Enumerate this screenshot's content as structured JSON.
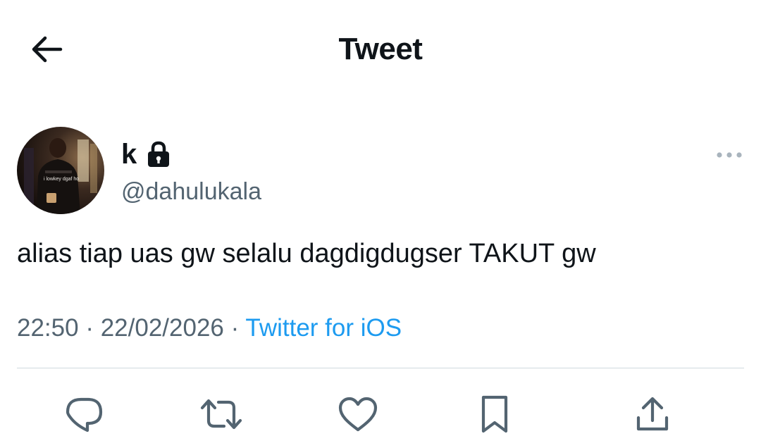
{
  "header": {
    "title": "Tweet",
    "back_icon": "arrow-left-icon"
  },
  "tweet": {
    "author": {
      "display_name": "k",
      "handle": "@dahulukala",
      "protected_icon": "lock-icon",
      "avatar_caption": "i lowkey dgaf ho"
    },
    "more_icon": "more-horizontal-icon",
    "text": "alias tiap uas gw selalu dagdigdugser TAKUT gw",
    "time": "22:50",
    "separator": "·",
    "date": "22/02/2026",
    "source": "Twitter for iOS"
  },
  "actions": [
    {
      "name": "reply",
      "icon": "reply-icon"
    },
    {
      "name": "retweet",
      "icon": "retweet-icon"
    },
    {
      "name": "like",
      "icon": "heart-icon"
    },
    {
      "name": "bookmark",
      "icon": "bookmark-icon"
    },
    {
      "name": "share",
      "icon": "share-icon"
    }
  ],
  "colors": {
    "text_primary": "#0f1419",
    "text_secondary": "#536471",
    "accent": "#1d9bf0",
    "divider": "#cfd9de",
    "icon": "#536471"
  }
}
